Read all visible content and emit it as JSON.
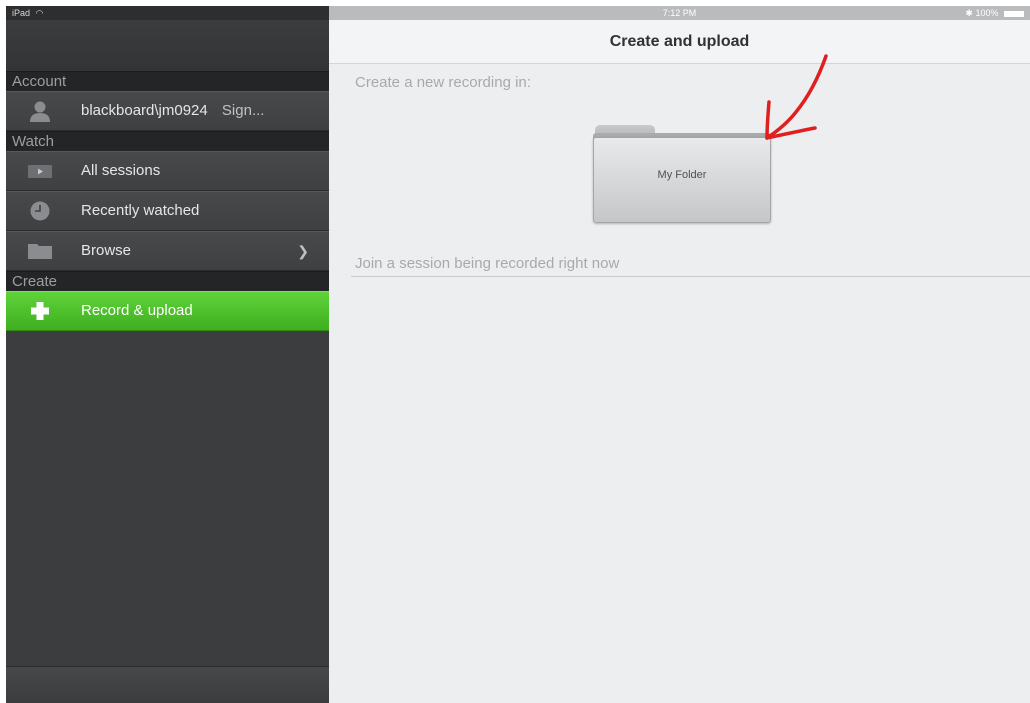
{
  "device": {
    "name": "iPad",
    "time": "7:12 PM",
    "battery": "100%"
  },
  "header": {
    "title": "Create and upload"
  },
  "sidebar": {
    "sections": [
      {
        "title": "Account"
      },
      {
        "title": "Watch"
      },
      {
        "title": "Create"
      }
    ],
    "account": {
      "label": "blackboard\\jm0924",
      "action": "Sign..."
    },
    "items": [
      {
        "label": "All sessions",
        "icon": "video-icon"
      },
      {
        "label": "Recently watched",
        "icon": "clock-icon"
      },
      {
        "label": "Browse",
        "icon": "folder-icon"
      },
      {
        "label": "Record & upload",
        "icon": "plus-icon",
        "active": true
      }
    ]
  },
  "main": {
    "new_recording_label": "Create a new recording in:",
    "folder": {
      "label": "My Folder"
    },
    "join_label": "Join a session being recorded right now"
  },
  "colors": {
    "accent_green": "#4cbf2a",
    "annotation_red": "#e02020"
  }
}
